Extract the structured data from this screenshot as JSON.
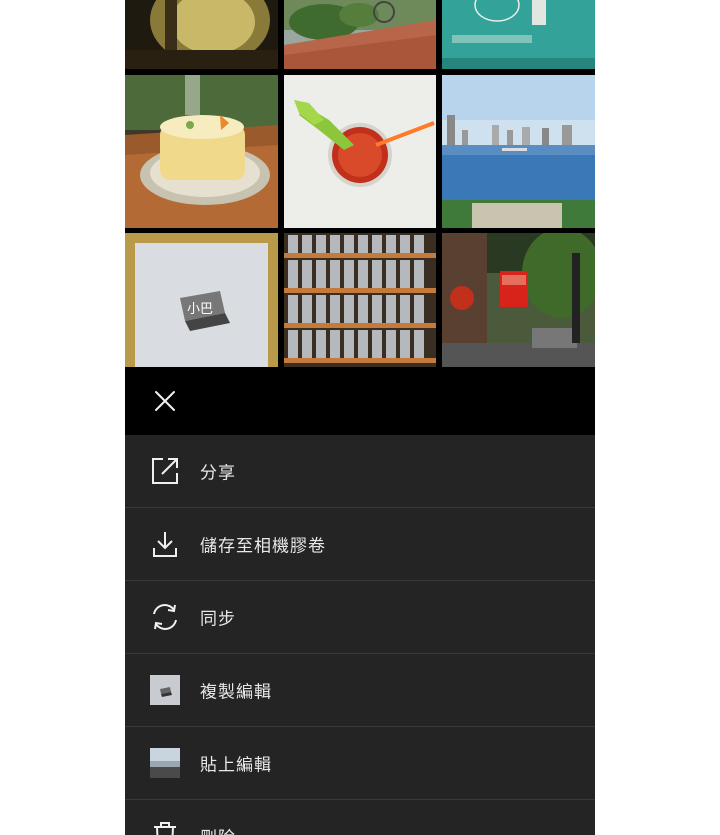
{
  "menu": {
    "items": [
      {
        "label": "分享",
        "icon": "share-icon"
      },
      {
        "label": "儲存至相機膠卷",
        "icon": "download-icon"
      },
      {
        "label": "同步",
        "icon": "sync-icon"
      },
      {
        "label": "複製編輯",
        "icon": "thumbnail-copy-edits"
      },
      {
        "label": "貼上編輯",
        "icon": "thumbnail-paste-edits"
      },
      {
        "label": "刪除",
        "icon": "trash-icon"
      }
    ]
  },
  "header": {
    "close_icon": "close-icon"
  },
  "photos": [
    {
      "subject": "cafe-sign"
    },
    {
      "subject": "plants-brick-path"
    },
    {
      "subject": "teal-shop-sign"
    },
    {
      "subject": "cake"
    },
    {
      "subject": "tomato-juice"
    },
    {
      "subject": "city-river"
    },
    {
      "subject": "stamp-block"
    },
    {
      "subject": "type-blocks"
    },
    {
      "subject": "street-sign"
    }
  ],
  "colors": {
    "sheet_bg": "#242424",
    "header_bg": "#000000",
    "text": "#e8e8e8",
    "divider": "#3a3a3a"
  }
}
